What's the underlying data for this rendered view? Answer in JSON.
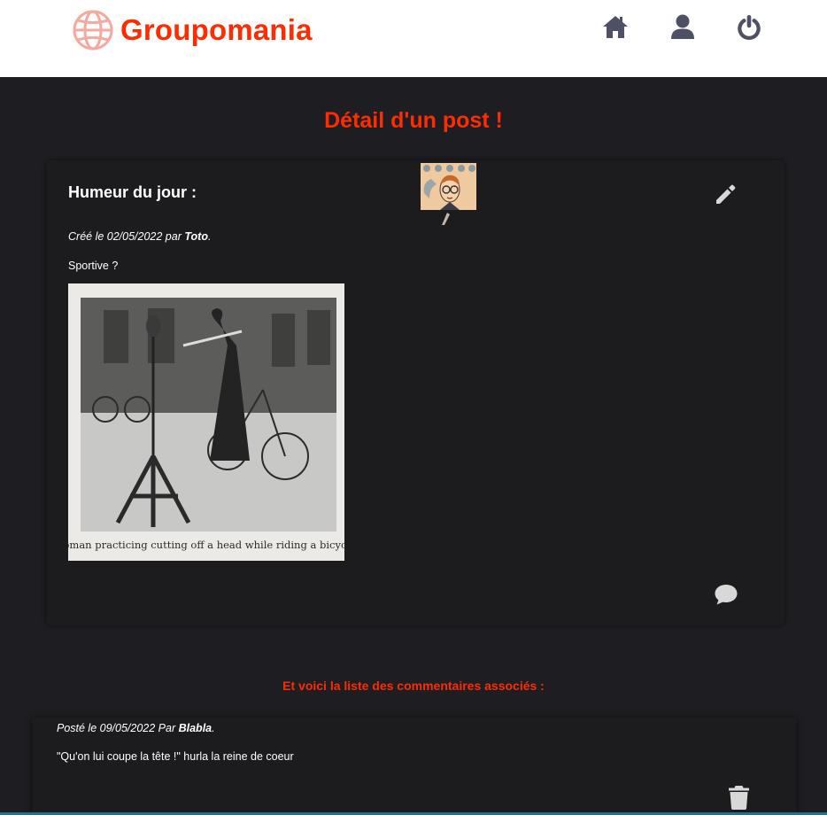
{
  "header": {
    "brand": "Groupomania",
    "brand_color": "#fd2d01",
    "logo_icon": "globe-icon",
    "nav": [
      {
        "icon": "home-icon"
      },
      {
        "icon": "user-icon"
      },
      {
        "icon": "power-icon"
      }
    ]
  },
  "page": {
    "title": "Détail d'un post !"
  },
  "post": {
    "title": "Humeur du jour :",
    "meta_prefix": "Créé le 02/05/2022 par ",
    "author": "Toto",
    "meta_suffix": ".",
    "text": "Sportive ?",
    "image_caption": "Woman practicing cutting off a head while riding a bicycle.",
    "edit_icon": "pencil-icon",
    "comment_icon": "comment-icon"
  },
  "comments": {
    "heading": "Et voici la liste des commentaires associés :",
    "items": [
      {
        "meta_prefix": "Posté le 09/05/2022 Par ",
        "author": "Blabla",
        "meta_suffix": ".",
        "text": "\"Qu'on lui coupe la tête !\" hurla la reine de coeur",
        "delete_icon": "trash-icon"
      }
    ]
  }
}
